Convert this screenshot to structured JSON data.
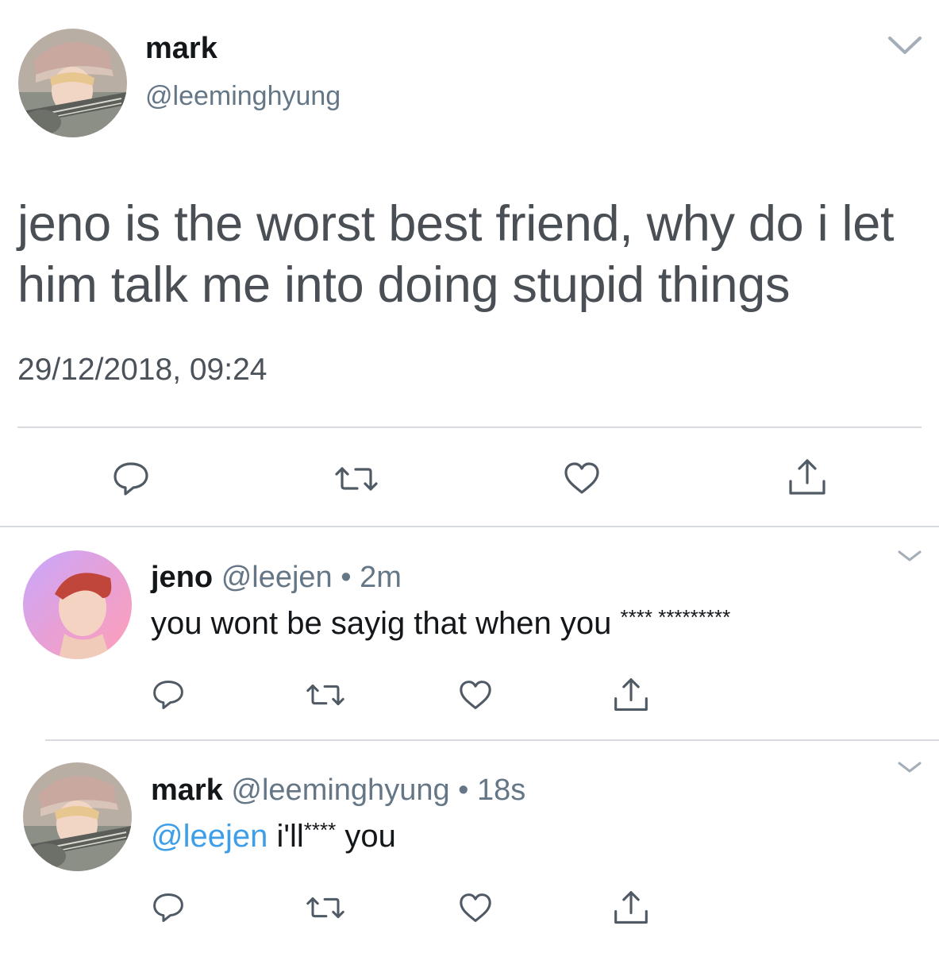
{
  "main_tweet": {
    "name": "mark",
    "handle": "@leeminghyung",
    "text": "jeno is the worst best friend, why do i let him talk me into doing stupid things",
    "timestamp": "29/12/2018, 09:24",
    "icons": [
      "reply-icon",
      "retweet-icon",
      "like-icon",
      "share-icon",
      "chevron-down-icon"
    ]
  },
  "replies": [
    {
      "name": "jeno",
      "handle": "@leejen",
      "separator": "•",
      "time": "2m",
      "text": "you wont be sayig that when you",
      "censored": "**** *********"
    },
    {
      "name": "mark",
      "handle": "@leeminghyung",
      "separator": "•",
      "time": "18s",
      "mention": "@leejen",
      "text_before": "i'll",
      "censored": "****",
      "text_after": "you"
    }
  ],
  "colors": {
    "mention": "#3e9ee8",
    "secondary_text": "#657786",
    "icon": "#657786",
    "divider": "#d7dbdf"
  }
}
